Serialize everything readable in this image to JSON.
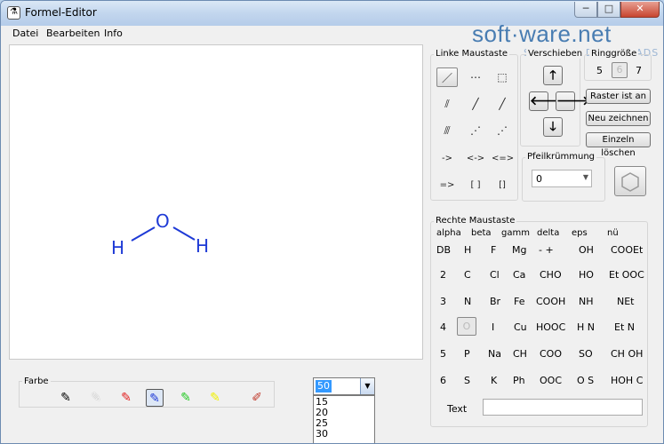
{
  "window": {
    "title": "Formel-Editor",
    "icon": "flask-icon",
    "min": "─",
    "max": "□",
    "close": "✕"
  },
  "menu": [
    "Datei",
    "Bearbeiten",
    "Info"
  ],
  "watermark": {
    "brand": "soft·ware.net",
    "tagline": "SCHNELLE DOWNLOADS"
  },
  "molecule": {
    "atoms": [
      "H",
      "O",
      "H"
    ],
    "bond_color": "#1e3ad6"
  },
  "farbe": {
    "label": "Farbe",
    "brushes": [
      {
        "color": "#000000",
        "selected": false
      },
      {
        "color": "#ffffff",
        "selected": false
      },
      {
        "color": "#e11d1d",
        "selected": false
      },
      {
        "color": "#1e3ad6",
        "selected": true
      },
      {
        "color": "#23c823",
        "selected": false
      },
      {
        "color": "#f0f000",
        "selected": false
      },
      {
        "color": "multicolor",
        "selected": false
      }
    ]
  },
  "size_combo": {
    "value": "50",
    "options": [
      "15",
      "20",
      "25",
      "30"
    ]
  },
  "linke_maustaste": {
    "label": "Linke Maustaste",
    "row1": [
      "／",
      "⋯",
      "⬚"
    ],
    "row2": [
      "⫽",
      "╱",
      "╱"
    ],
    "row3": [
      "⫻",
      "⋰",
      "⋰"
    ],
    "row4": [
      "->",
      "<->",
      "<=>"
    ],
    "row5": [
      "=>",
      "[ ]",
      "[]"
    ]
  },
  "verschieben": {
    "label": "Verschieben",
    "up": "🡑",
    "left": "🡐",
    "right": "🡒",
    "down": "🡓"
  },
  "ringgroesse": {
    "label": "Ringgröße",
    "opt_a": "5",
    "opt_b": "6",
    "opt_c": "7"
  },
  "buttons": {
    "raster": "Raster ist an",
    "neu": "Neu zeichnen",
    "einzeln": "Einzeln löschen"
  },
  "pfeilkruemmung": {
    "label": "Pfeilkrümmung",
    "value": "0"
  },
  "rechte_maustaste": {
    "label": "Rechte Maustaste",
    "greek": [
      "alpha",
      "beta",
      "gamm",
      "delta",
      "eps",
      "nü"
    ],
    "rows": [
      [
        "DB",
        "H",
        "F",
        "Mg",
        "-    +",
        "OH",
        "COOEt"
      ],
      [
        "2",
        "C",
        "Cl",
        "Ca",
        "CHO",
        "HO",
        "Et OOC"
      ],
      [
        "3",
        "N",
        "Br",
        "Fe",
        "COOH",
        "NH",
        "NEt"
      ],
      [
        "4",
        "O",
        "I",
        "Cu",
        "HOOC",
        "H N",
        "Et N"
      ],
      [
        "5",
        "P",
        "Na",
        "CH",
        "COO",
        "SO",
        "CH OH"
      ],
      [
        "6",
        "S",
        "K",
        "Ph",
        "OOC",
        "O S",
        "HOH C"
      ]
    ],
    "text_label": "Text",
    "text_value": ""
  }
}
